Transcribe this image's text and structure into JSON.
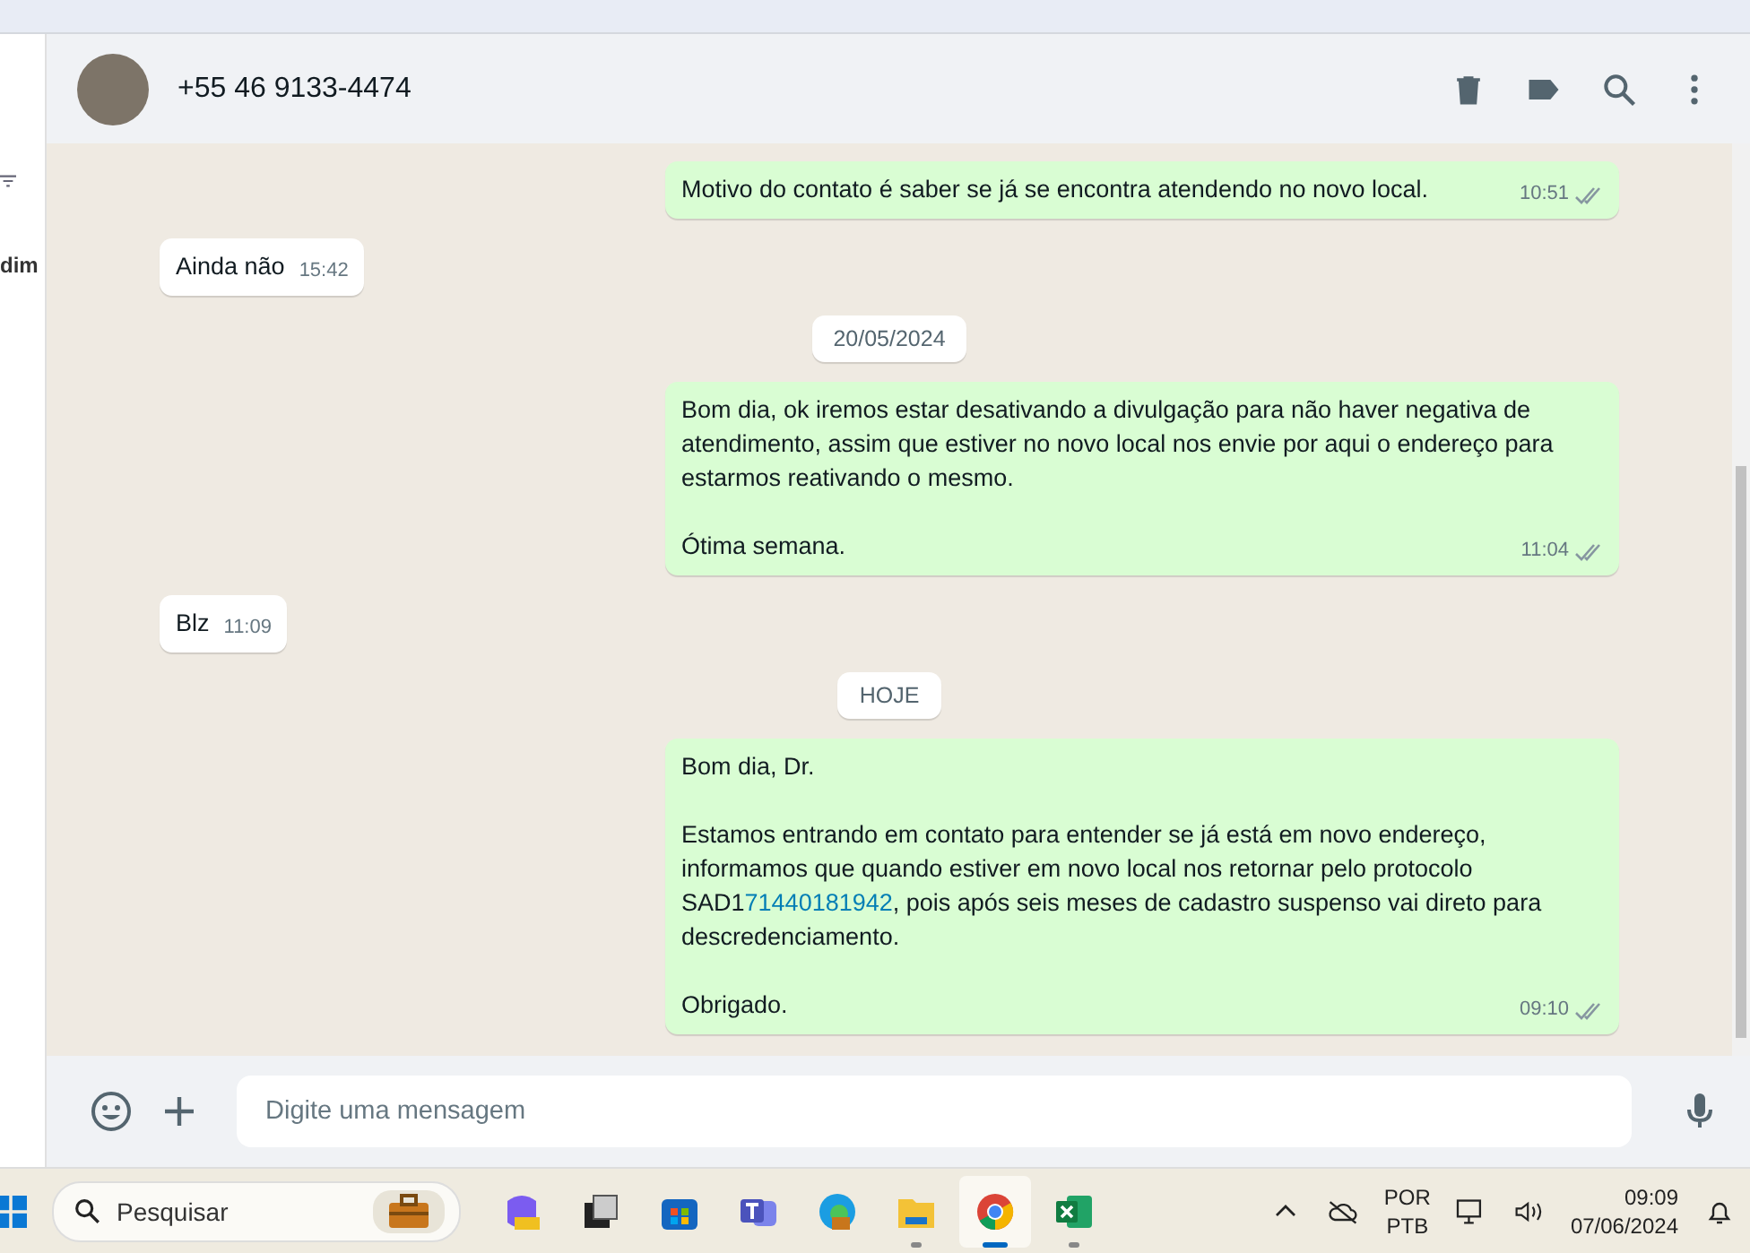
{
  "sidebar": {
    "fragment": "dim"
  },
  "contact": {
    "phone": "+55 46 9133-4474"
  },
  "messages": [
    {
      "kind": "outgoing",
      "paragraphs": [
        [
          {
            "text": "Motivo do contato é saber se já se encontra atendendo no novo local.",
            "link": false
          }
        ]
      ],
      "time": "10:51"
    },
    {
      "kind": "incoming",
      "paragraphs": [
        [
          {
            "text": "Ainda não",
            "link": false
          }
        ]
      ],
      "time": "15:42"
    },
    {
      "kind": "date",
      "label": "20/05/2024"
    },
    {
      "kind": "outgoing",
      "paragraphs": [
        [
          {
            "text": "Bom dia, ok iremos estar desativando a divulgação para não haver negativa de atendimento, assim que estiver no novo local nos envie por aqui o endereço para estarmos reativando o mesmo.",
            "link": false
          }
        ],
        [
          {
            "text": "Ótima semana.",
            "link": false
          }
        ]
      ],
      "time": "11:04"
    },
    {
      "kind": "incoming",
      "paragraphs": [
        [
          {
            "text": "Blz",
            "link": false
          }
        ]
      ],
      "time": "11:09"
    },
    {
      "kind": "date",
      "label": "HOJE"
    },
    {
      "kind": "outgoing",
      "paragraphs": [
        [
          {
            "text": "Bom dia, Dr.",
            "link": false
          }
        ],
        [
          {
            "text": "Estamos entrando em contato para entender se já está em novo endereço, informamos que quando estiver em novo local nos retornar pelo protocolo SAD1",
            "link": false
          },
          {
            "text": "71440181942",
            "link": true
          },
          {
            "text": ", pois após seis meses de cadastro suspenso vai direto para descredenciamento.",
            "link": false
          }
        ],
        [
          {
            "text": "Obrigado.",
            "link": false
          }
        ]
      ],
      "time": "09:10"
    }
  ],
  "composer": {
    "placeholder": "Digite uma mensagem"
  },
  "taskbar": {
    "search": {
      "placeholder": "Pesquisar"
    },
    "apps": [
      {
        "kind": "copilot",
        "running": false,
        "selected": false
      },
      {
        "kind": "taskview",
        "running": false,
        "selected": false
      },
      {
        "kind": "store",
        "running": false,
        "selected": false
      },
      {
        "kind": "teams",
        "running": false,
        "selected": false
      },
      {
        "kind": "edge",
        "running": false,
        "selected": false
      },
      {
        "kind": "files",
        "running": true,
        "selected": false
      },
      {
        "kind": "chrome",
        "running": true,
        "selected": true
      },
      {
        "kind": "excel",
        "running": true,
        "selected": false
      }
    ],
    "language": "POR",
    "layout": "PTB",
    "time": "09:09",
    "date": "07/06/2024"
  }
}
